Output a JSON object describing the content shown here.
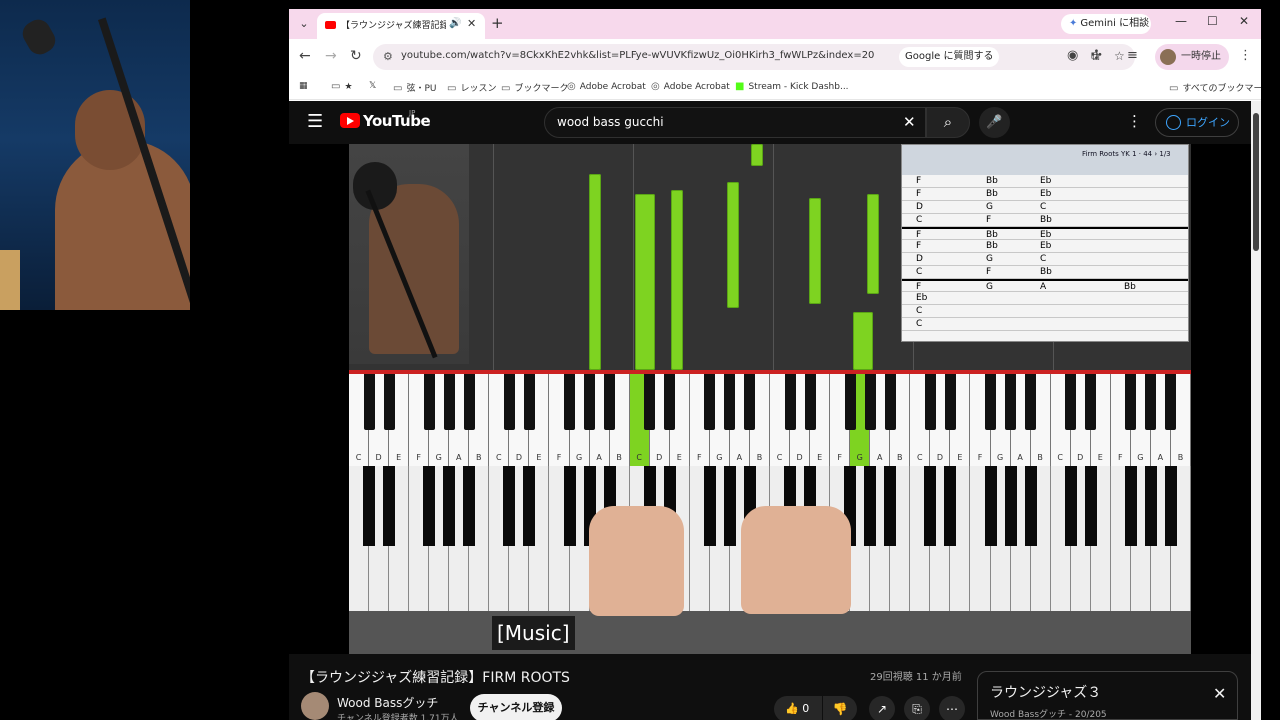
{
  "browser": {
    "tab": {
      "title": "【ラウンジジャズ練習記録】FIRM ROOTS"
    },
    "gemini_label": "Gemini に相談",
    "url": "youtube.com/watch?v=8CkxKhE2vhk&list=PLFye-wVUVKfizwUz_Oi0HKirh3_fwWLPz&index=20",
    "ask_google": "Google に質問する",
    "profile_label": "一時停止中",
    "bookmarks": [
      "弦・PU",
      "レッスン",
      "ブックマーク",
      "Adobe Acrobat",
      "Adobe Acrobat",
      "Stream - Kick Dashb..."
    ],
    "all_bookmarks": "すべてのブックマーク"
  },
  "youtube": {
    "wordmark": "YouTube",
    "country": "JP",
    "search_query": "wood bass gucchi",
    "login_label": "ログイン"
  },
  "video": {
    "caption": "[Music]",
    "title": "【ラウンジジャズ練習記録】FIRM ROOTS",
    "meta": "29回視聴  11 か月前",
    "channel": "Wood Bassグッチ",
    "subs": "チャンネル登録者数 1.71万人",
    "subscribe_label": "チャンネル登録",
    "likes": "0"
  },
  "playlist": {
    "title": "ラウンジジャズ３",
    "meta": "Wood Bassグッチ - 20/205"
  },
  "chart": {
    "song": "Firm Roots YK  1  ·  44  ›  1/3",
    "rows": [
      [
        "F",
        "Bb",
        "Eb",
        ""
      ],
      [
        "F",
        "Bb",
        "Eb",
        ""
      ],
      [
        "D",
        "G",
        "C",
        ""
      ],
      [
        "C",
        "F",
        "Bb",
        ""
      ],
      [
        "F",
        "Bb",
        "Eb",
        ""
      ],
      [
        "F",
        "Bb",
        "Eb",
        ""
      ],
      [
        "D",
        "G",
        "C",
        ""
      ],
      [
        "C",
        "F",
        "Bb",
        ""
      ],
      [
        "F",
        "G",
        "A",
        "Bb"
      ],
      [
        "Eb",
        "",
        "",
        ""
      ],
      [
        "C",
        "",
        "",
        ""
      ],
      [
        "C",
        "",
        "",
        ""
      ]
    ]
  },
  "keyboard": {
    "labels": [
      "C",
      "D",
      "E",
      "F",
      "G",
      "A",
      "B",
      "C",
      "D",
      "E",
      "F",
      "G",
      "A",
      "B",
      "C",
      "D",
      "E",
      "F",
      "G",
      "A",
      "B",
      "C",
      "D",
      "E",
      "F",
      "G",
      "A",
      "B",
      "C",
      "D",
      "E",
      "F",
      "G",
      "A",
      "B",
      "C",
      "D",
      "E",
      "F",
      "G",
      "A",
      "B"
    ]
  },
  "colors": {
    "note_green": "#7ed321",
    "youtube_red": "#ff0000",
    "tab_pink": "#f7d9ec"
  }
}
